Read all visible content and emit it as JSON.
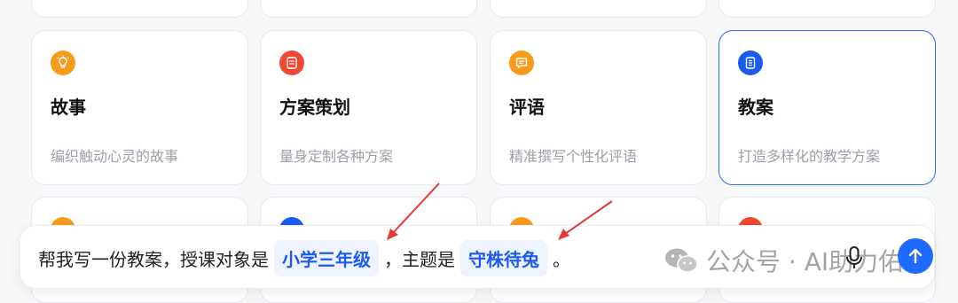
{
  "colors": {
    "orange": "#f79b1b",
    "red": "#f04832",
    "blue": "#1a5cf0",
    "accent_border": "#2d6bff",
    "annotation_arrow": "#e53935"
  },
  "cards": [
    {
      "title": "故事",
      "desc": "编织触动心灵的故事",
      "icon": "lightbulb-icon"
    },
    {
      "title": "方案策划",
      "desc": "量身定制各种方案",
      "icon": "document-icon"
    },
    {
      "title": "评语",
      "desc": "精准撰写个性化评语",
      "icon": "comment-icon"
    },
    {
      "title": "教案",
      "desc": "打造多样化的教学方案",
      "icon": "notebook-icon",
      "selected": true
    }
  ],
  "composer": {
    "prefix": "帮我写一份教案，授课对象是",
    "chip1": "小学三年级",
    "middle": "，主题是",
    "chip2": "守株待兔",
    "suffix": "。"
  },
  "watermark": {
    "text": "公众号 · AI助力佑"
  },
  "icons": {
    "mic": "microphone-icon",
    "send": "arrow-up-icon"
  }
}
